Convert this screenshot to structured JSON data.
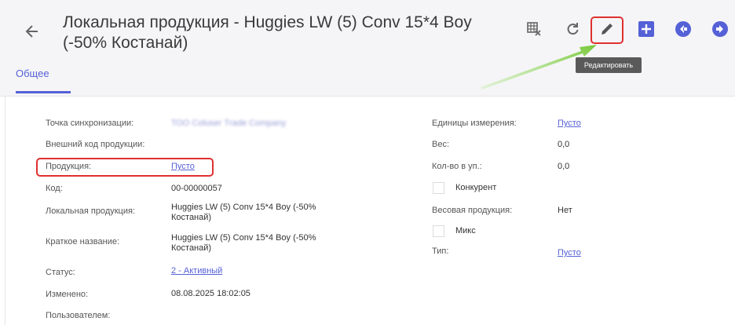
{
  "header": {
    "title": "Локальная продукция - Huggies LW (5) Conv 15*4 Boy (-50% Костанай)",
    "tooltip": "Редактировать",
    "icons": [
      "table-delete-icon",
      "refresh-icon",
      "edit-icon",
      "add-icon",
      "prev-icon",
      "next-icon"
    ],
    "accent": "#5561d6"
  },
  "tabs": [
    {
      "label": "Общее"
    }
  ],
  "left_fields": [
    {
      "label": "Точка синхронизации:",
      "value": "ТОО Сoluser Тrade Сompany"
    },
    {
      "label": "Внешний код продукции:",
      "value": ""
    },
    {
      "label": "Продукция:",
      "value": "Пусто"
    },
    {
      "label": "Код:",
      "value": "00-00000057"
    },
    {
      "label": "Локальная продукция:",
      "value": "Huggies LW (5) Conv 15*4 Boy (-50% Костанай)"
    },
    {
      "label": "Краткое название:",
      "value": "Huggies LW (5) Conv 15*4 Boy (-50% Костанай)"
    },
    {
      "label": "Статус:",
      "value": "2 - Активный"
    },
    {
      "label": "Изменено:",
      "value": "08.08.2025 18:02:05"
    },
    {
      "label": "Пользователем:",
      "value": ""
    }
  ],
  "right_fields": {
    "units": {
      "label": "Единицы измерения:",
      "value": "Пусто"
    },
    "weight": {
      "label": "Вес:",
      "value": "0,0"
    },
    "qty_pack": {
      "label": "Кол-во в уп.:",
      "value": "0,0"
    },
    "competitor": {
      "label": "Конкурент",
      "checked": false
    },
    "weight_product": {
      "label": "Весовая продукция:",
      "value": "Нет"
    },
    "mix": {
      "label": "Микс",
      "checked": false
    },
    "type": {
      "label": "Тип:",
      "value": "Пусто"
    }
  }
}
